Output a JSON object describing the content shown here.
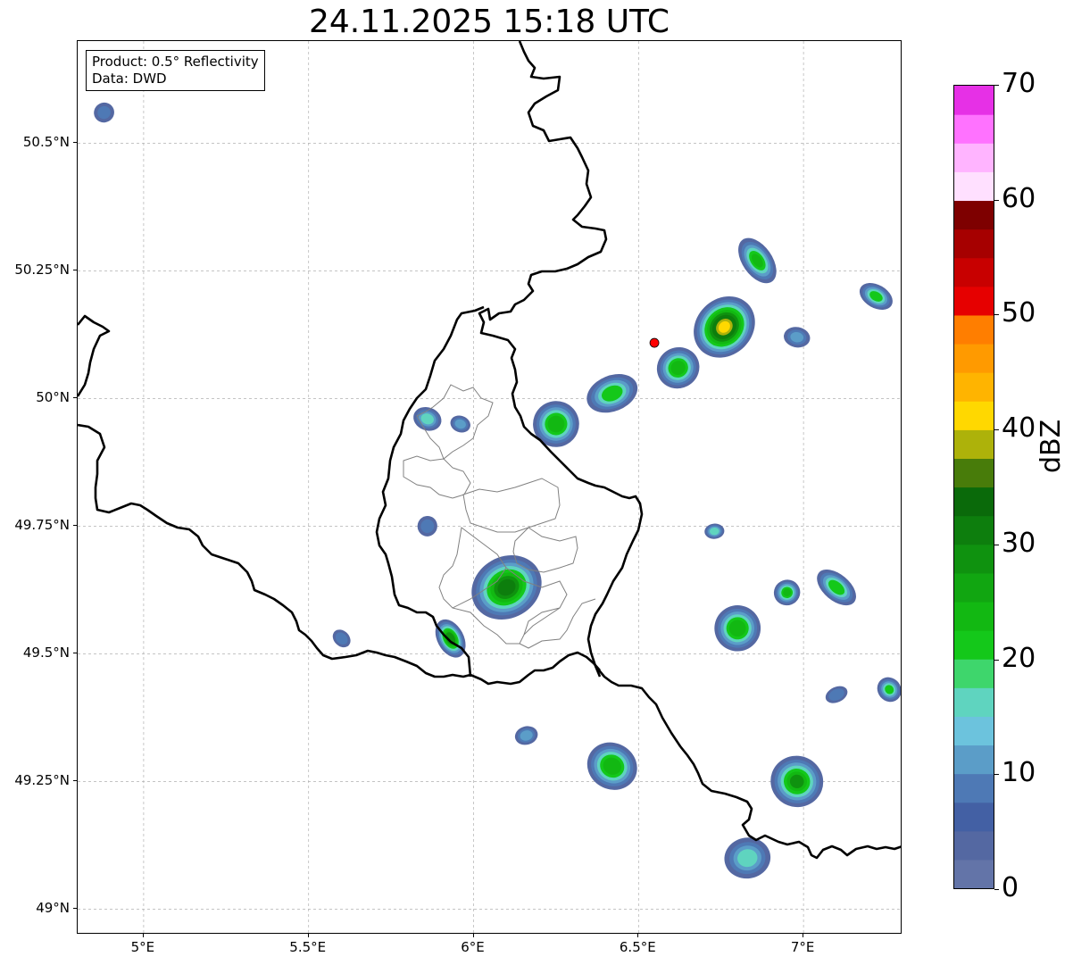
{
  "title": "24.11.2025 15:18 UTC",
  "info": {
    "product": "Product: 0.5° Reflectivity",
    "source": "Data: DWD"
  },
  "map": {
    "lon_range": [
      4.8,
      7.3
    ],
    "lat_range": [
      48.95,
      50.7
    ],
    "lat_ticks": [
      {
        "value": 50.5,
        "label": "50.5°N"
      },
      {
        "value": 50.25,
        "label": "50.25°N"
      },
      {
        "value": 50.0,
        "label": "50°N"
      },
      {
        "value": 49.75,
        "label": "49.75°N"
      },
      {
        "value": 49.5,
        "label": "49.5°N"
      },
      {
        "value": 49.25,
        "label": "49.25°N"
      },
      {
        "value": 49.0,
        "label": "49°N"
      }
    ],
    "lon_ticks": [
      {
        "value": 5.0,
        "label": "5°E"
      },
      {
        "value": 5.5,
        "label": "5.5°E"
      },
      {
        "value": 6.0,
        "label": "6°E"
      },
      {
        "value": 6.5,
        "label": "6.5°E"
      },
      {
        "value": 7.0,
        "label": "7°E"
      }
    ],
    "radar_site": {
      "lon": 6.548,
      "lat": 50.109,
      "color": "#ff0000"
    },
    "gridline_color": "#b0b0b0",
    "border_color": "#000000",
    "admin_border_color": "#808080"
  },
  "colorbar": {
    "label": "dBZ",
    "min": 0,
    "max": 70,
    "tick_labels": [
      "0",
      "10",
      "20",
      "30",
      "40",
      "50",
      "60",
      "70"
    ],
    "colors": [
      "#6374a8",
      "#5468a2",
      "#4360a4",
      "#4e79b5",
      "#5b9dc8",
      "#6cc3dd",
      "#5fd4bf",
      "#3ed66c",
      "#14c81a",
      "#12b812",
      "#11a611",
      "#0f920f",
      "#0d7e0d",
      "#0a6a0a",
      "#487c0a",
      "#adb20a",
      "#ffd800",
      "#ffb400",
      "#ff9a00",
      "#ff7e00",
      "#e60000",
      "#c80000",
      "#a60000",
      "#7e0000",
      "#ffe0ff",
      "#ffb4ff",
      "#ff72ff",
      "#e630e6"
    ]
  },
  "echoes": [
    {
      "lon": 6.25,
      "lat": 49.95,
      "len": 0.14,
      "wid": 0.045,
      "ang": 25,
      "max": 27
    },
    {
      "lon": 6.42,
      "lat": 50.01,
      "len": 0.16,
      "wid": 0.035,
      "ang": 22,
      "max": 23
    },
    {
      "lon": 6.62,
      "lat": 50.06,
      "len": 0.13,
      "wid": 0.04,
      "ang": 28,
      "max": 26
    },
    {
      "lon": 6.76,
      "lat": 50.14,
      "len": 0.2,
      "wid": 0.055,
      "ang": 45,
      "max": 42
    },
    {
      "lon": 6.86,
      "lat": 50.27,
      "len": 0.09,
      "wid": 0.05,
      "ang": 35,
      "max": 24
    },
    {
      "lon": 7.22,
      "lat": 50.2,
      "len": 0.07,
      "wid": 0.035,
      "ang": 60,
      "max": 22
    },
    {
      "lon": 6.98,
      "lat": 50.12,
      "len": 0.08,
      "wid": 0.02,
      "ang": -10,
      "max": 12
    },
    {
      "lon": 5.86,
      "lat": 49.96,
      "len": 0.07,
      "wid": 0.028,
      "ang": 70,
      "max": 18
    },
    {
      "lon": 5.96,
      "lat": 49.95,
      "len": 0.05,
      "wid": 0.02,
      "ang": 70,
      "max": 14
    },
    {
      "lon": 6.1,
      "lat": 49.63,
      "len": 0.22,
      "wid": 0.06,
      "ang": 30,
      "max": 33
    },
    {
      "lon": 5.93,
      "lat": 49.53,
      "len": 0.08,
      "wid": 0.04,
      "ang": 28,
      "max": 31
    },
    {
      "lon": 5.86,
      "lat": 49.75,
      "len": 0.06,
      "wid": 0.02,
      "ang": -15,
      "max": 9
    },
    {
      "lon": 6.8,
      "lat": 49.55,
      "len": 0.14,
      "wid": 0.045,
      "ang": 12,
      "max": 27
    },
    {
      "lon": 6.95,
      "lat": 49.62,
      "len": 0.08,
      "wid": 0.025,
      "ang": 20,
      "max": 24
    },
    {
      "lon": 7.1,
      "lat": 49.63,
      "len": 0.08,
      "wid": 0.045,
      "ang": 50,
      "max": 23
    },
    {
      "lon": 7.26,
      "lat": 49.43,
      "len": 0.07,
      "wid": 0.025,
      "ang": 40,
      "max": 21
    },
    {
      "lon": 7.1,
      "lat": 49.42,
      "len": 0.07,
      "wid": 0.015,
      "ang": 25,
      "max": 11
    },
    {
      "lon": 6.73,
      "lat": 49.74,
      "len": 0.06,
      "wid": 0.015,
      "ang": 5,
      "max": 19
    },
    {
      "lon": 6.42,
      "lat": 49.28,
      "len": 0.14,
      "wid": 0.05,
      "ang": 60,
      "max": 27
    },
    {
      "lon": 6.98,
      "lat": 49.25,
      "len": 0.16,
      "wid": 0.05,
      "ang": -20,
      "max": 28
    },
    {
      "lon": 6.83,
      "lat": 49.1,
      "len": 0.14,
      "wid": 0.04,
      "ang": 8,
      "max": 17
    },
    {
      "lon": 6.16,
      "lat": 49.34,
      "len": 0.07,
      "wid": 0.018,
      "ang": 15,
      "max": 14
    },
    {
      "lon": 4.88,
      "lat": 50.56,
      "len": 0.06,
      "wid": 0.02,
      "ang": -60,
      "max": 8
    },
    {
      "lon": 5.6,
      "lat": 49.53,
      "len": 0.06,
      "wid": 0.015,
      "ang": -45,
      "max": 10
    }
  ]
}
